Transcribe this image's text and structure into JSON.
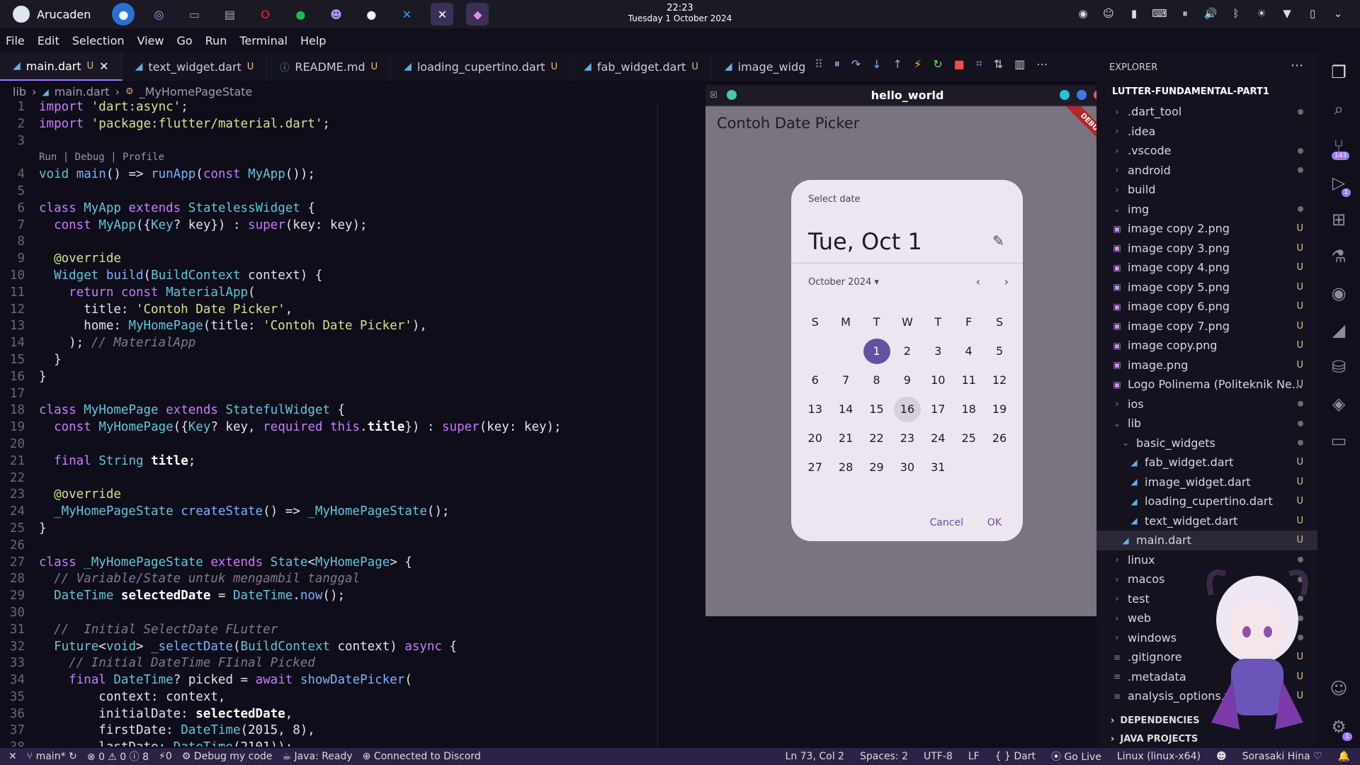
{
  "topbar": {
    "user": "Arucaden",
    "clock_time": "22:23",
    "clock_date": "Tuesday 1 October 2024"
  },
  "menu": [
    "File",
    "Edit",
    "Selection",
    "View",
    "Go",
    "Run",
    "Terminal",
    "Help"
  ],
  "tabs": [
    {
      "label": "main.dart",
      "status": "U",
      "active": true
    },
    {
      "label": "text_widget.dart",
      "status": "U"
    },
    {
      "label": "README.md",
      "status": "U"
    },
    {
      "label": "loading_cupertino.dart",
      "status": "U"
    },
    {
      "label": "fab_widget.dart",
      "status": "U"
    },
    {
      "label": "image_widg",
      "status": ""
    }
  ],
  "breadcrumb": {
    "part1": "lib",
    "part2": "main.dart",
    "part3": "_MyHomePageState"
  },
  "codelens": "Run | Debug | Profile",
  "app_window": {
    "title": "hello_world",
    "appbar_title": "Contoh Date Picker",
    "debug_banner": "DEBUG"
  },
  "date_picker": {
    "help_text": "Select date",
    "headline": "Tue, Oct 1",
    "month_label": "October 2024 ▾",
    "weekdays": [
      "S",
      "M",
      "T",
      "W",
      "T",
      "F",
      "S"
    ],
    "weeks": [
      [
        "",
        "",
        "1",
        "2",
        "3",
        "4",
        "5"
      ],
      [
        "6",
        "7",
        "8",
        "9",
        "10",
        "11",
        "12"
      ],
      [
        "13",
        "14",
        "15",
        "16",
        "17",
        "18",
        "19"
      ],
      [
        "20",
        "21",
        "22",
        "23",
        "24",
        "25",
        "26"
      ],
      [
        "27",
        "28",
        "29",
        "30",
        "31",
        "",
        ""
      ]
    ],
    "selected": "1",
    "hovered": "16",
    "cancel": "Cancel",
    "ok": "OK"
  },
  "explorer": {
    "header": "EXPLORER",
    "root": "LUTTER-FUNDAMENTAL-PART1",
    "items": [
      {
        "label": ".dart_tool",
        "indent": 1,
        "type": "folder",
        "mark": "dot"
      },
      {
        "label": ".idea",
        "indent": 1,
        "type": "folder",
        "mark": ""
      },
      {
        "label": ".vscode",
        "indent": 1,
        "type": "folder",
        "mark": "dot"
      },
      {
        "label": "android",
        "indent": 1,
        "type": "folder",
        "mark": "dot"
      },
      {
        "label": "build",
        "indent": 1,
        "type": "folder",
        "mark": ""
      },
      {
        "label": "img",
        "indent": 1,
        "type": "folder-open",
        "mark": "dot"
      },
      {
        "label": "image copy 2.png",
        "indent": 1,
        "type": "image",
        "mark": "U"
      },
      {
        "label": "image copy 3.png",
        "indent": 1,
        "type": "image",
        "mark": "U"
      },
      {
        "label": "image copy 4.png",
        "indent": 1,
        "type": "image",
        "mark": "U"
      },
      {
        "label": "image copy 5.png",
        "indent": 1,
        "type": "image",
        "mark": "U"
      },
      {
        "label": "image copy 6.png",
        "indent": 1,
        "type": "image",
        "mark": "U"
      },
      {
        "label": "image copy 7.png",
        "indent": 1,
        "type": "image",
        "mark": "U"
      },
      {
        "label": "image copy.png",
        "indent": 1,
        "type": "image",
        "mark": "U"
      },
      {
        "label": "image.png",
        "indent": 1,
        "type": "image",
        "mark": "U"
      },
      {
        "label": "Logo Polinema (Politeknik Ne...",
        "indent": 1,
        "type": "image",
        "mark": "U"
      },
      {
        "label": "ios",
        "indent": 1,
        "type": "folder",
        "mark": "dot"
      },
      {
        "label": "lib",
        "indent": 1,
        "type": "folder-open",
        "mark": "dot"
      },
      {
        "label": "basic_widgets",
        "indent": 2,
        "type": "folder-open",
        "mark": "dot"
      },
      {
        "label": "fab_widget.dart",
        "indent": 3,
        "type": "dart",
        "mark": "U"
      },
      {
        "label": "image_widget.dart",
        "indent": 3,
        "type": "dart",
        "mark": "U"
      },
      {
        "label": "loading_cupertino.dart",
        "indent": 3,
        "type": "dart",
        "mark": "U"
      },
      {
        "label": "text_widget.dart",
        "indent": 3,
        "type": "dart",
        "mark": "U"
      },
      {
        "label": "main.dart",
        "indent": 2,
        "type": "dart",
        "mark": "U",
        "selected": true
      },
      {
        "label": "linux",
        "indent": 1,
        "type": "folder",
        "mark": "dot"
      },
      {
        "label": "macos",
        "indent": 1,
        "type": "folder",
        "mark": "dot"
      },
      {
        "label": "test",
        "indent": 1,
        "type": "folder",
        "mark": "dot"
      },
      {
        "label": "web",
        "indent": 1,
        "type": "folder",
        "mark": "dot"
      },
      {
        "label": "windows",
        "indent": 1,
        "type": "folder",
        "mark": "dot"
      },
      {
        "label": ".gitignore",
        "indent": 1,
        "type": "file",
        "mark": "U"
      },
      {
        "label": ".metadata",
        "indent": 1,
        "type": "file",
        "mark": "U"
      },
      {
        "label": "analysis_options.yaml",
        "indent": 1,
        "type": "file",
        "mark": "U"
      }
    ],
    "sections": [
      "DEPENDENCIES",
      "JAVA PROJECTS"
    ]
  },
  "activity_badges": {
    "scm": "143",
    "debug": "1",
    "settings": "1"
  },
  "status": {
    "branch": "main*",
    "problems": "⊗ 0 ⚠ 0 ⓘ 8",
    "ports": "⚡0",
    "debug": "Debug my code",
    "java": "Java: Ready",
    "discord": "Connected to Discord",
    "position": "Ln 73, Col 2",
    "spaces": "Spaces: 2",
    "encoding": "UTF-8",
    "eol": "LF",
    "language": "{ } Dart",
    "golive": "Go Live",
    "platform": "Linux (linux-x64)",
    "user": "Sorasaki Hina ♡"
  }
}
